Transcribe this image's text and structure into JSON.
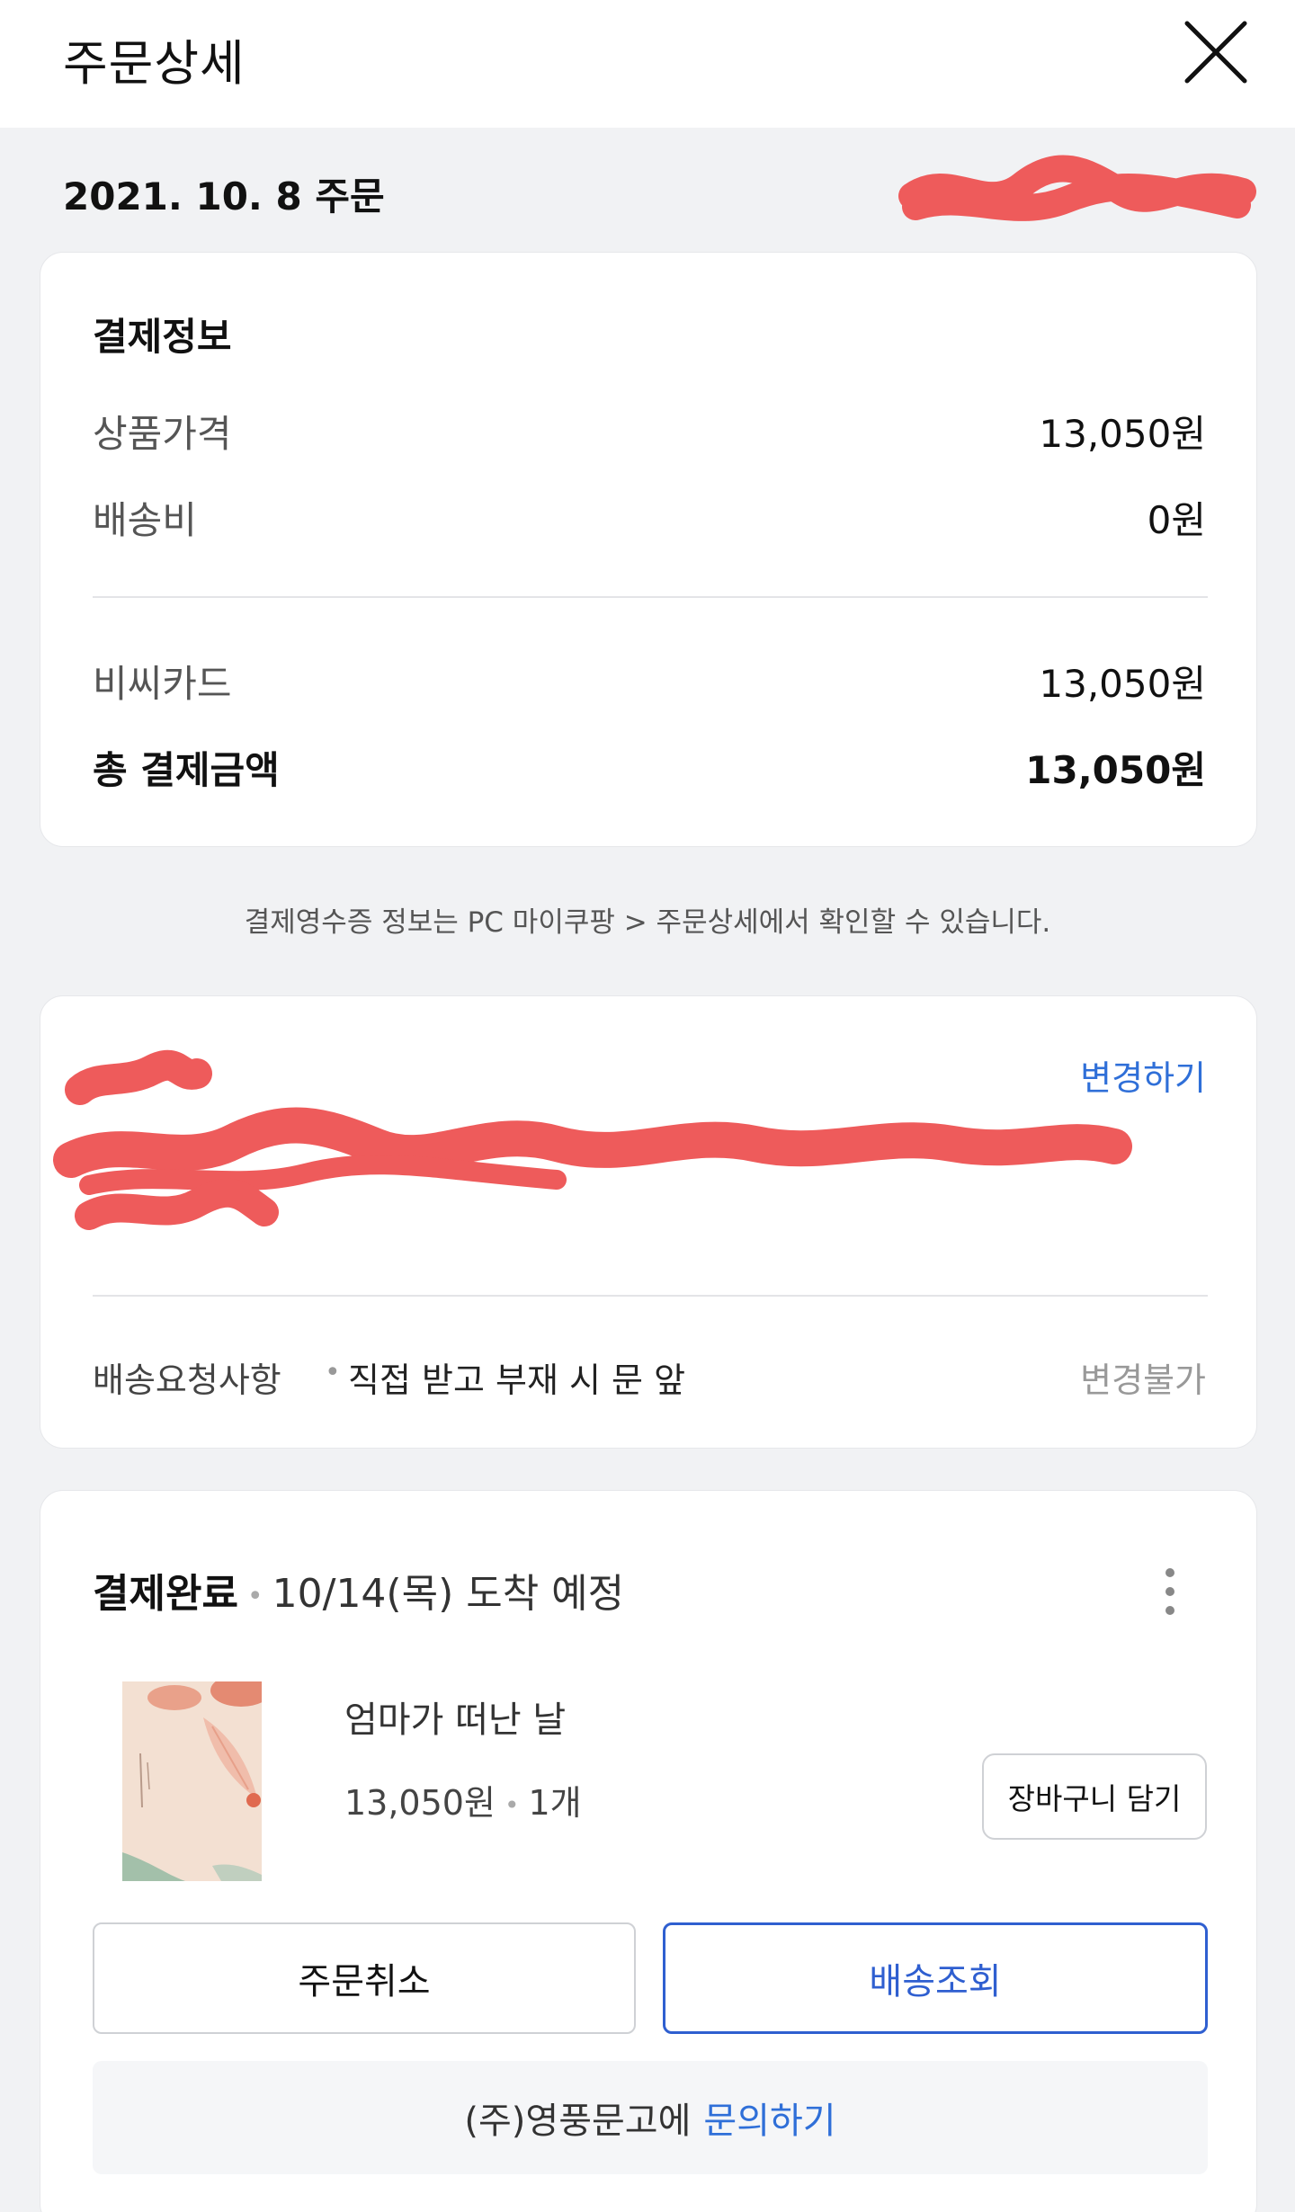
{
  "header": {
    "title": "주문상세",
    "close_icon": "close-icon"
  },
  "order": {
    "date_label": "2021. 10. 8 주문"
  },
  "payment": {
    "title": "결제정보",
    "rows": [
      {
        "label": "상품가격",
        "value": "13,050원"
      },
      {
        "label": "배송비",
        "value": "0원"
      },
      {
        "label": "비씨카드",
        "value": "13,050원"
      }
    ],
    "total_label": "총 결제금액",
    "total_value": "13,050원"
  },
  "receipt_note": "결제영수증 정보는 PC 마이쿠팡 > 주문상세에서 확인할 수 있습니다.",
  "shipping": {
    "change_link": "변경하기",
    "request_label": "배송요청사항",
    "request_value": "직접 받고 부재 시 문 앞",
    "request_status": "변경불가"
  },
  "order_item": {
    "status": "결제완료",
    "delivery_eta": "10/14(목) 도착 예정",
    "title": "엄마가 떠난 날",
    "price": "13,050원",
    "quantity": "1개",
    "cart_button": "장바구니 담기",
    "cancel_button": "주문취소",
    "track_button": "배송조회",
    "seller_text": "(주)영풍문고에",
    "inquiry_link": "문의하기"
  },
  "colors": {
    "accent_blue": "#2f6fd8",
    "redaction": "#ee5b5b",
    "background": "#f1f2f4"
  }
}
